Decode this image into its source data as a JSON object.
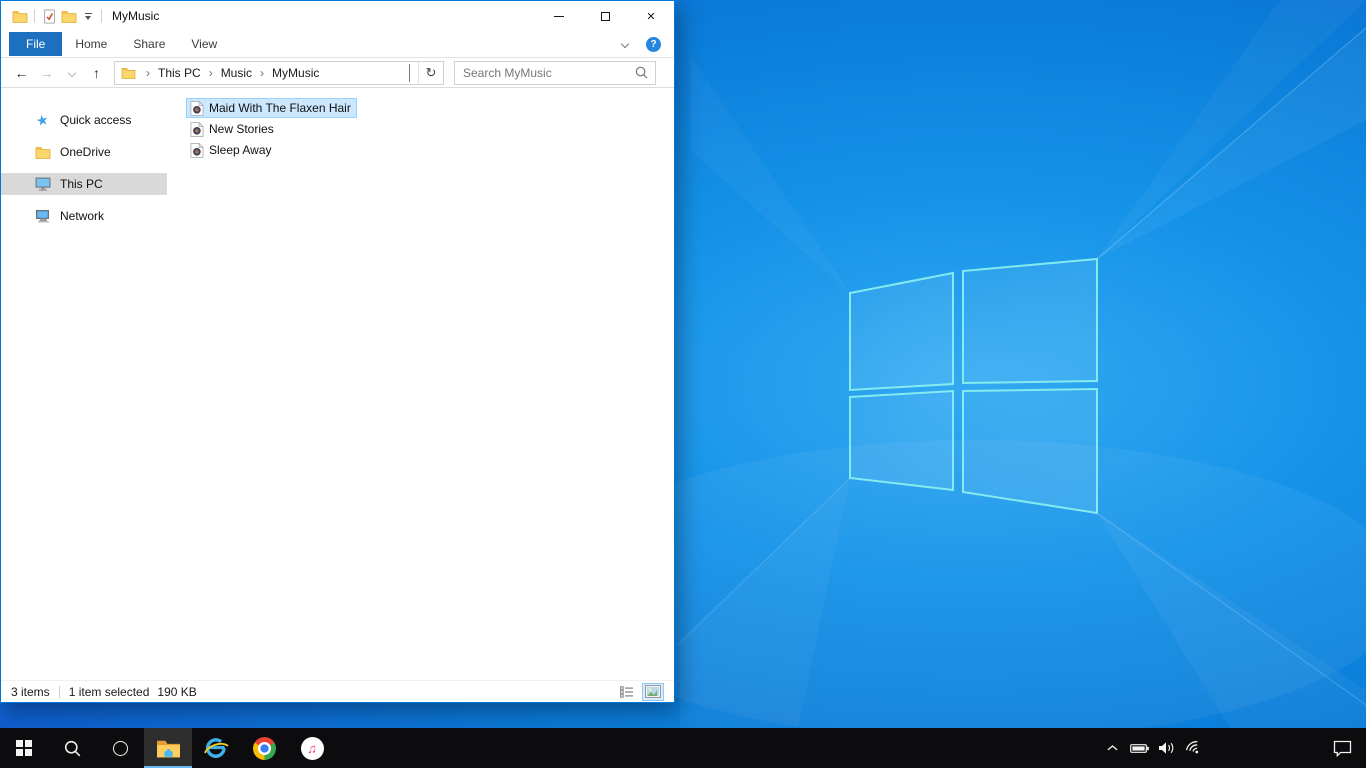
{
  "window": {
    "title": "MyMusic"
  },
  "ribbon": {
    "tabs": [
      "File",
      "Home",
      "Share",
      "View"
    ]
  },
  "address": {
    "breadcrumb": [
      "This PC",
      "Music",
      "MyMusic"
    ],
    "search_placeholder": "Search MyMusic"
  },
  "sidebar": {
    "items": [
      {
        "label": "Quick access",
        "icon": "quick-access-star"
      },
      {
        "label": "OneDrive",
        "icon": "onedrive-folder"
      },
      {
        "label": "This PC",
        "icon": "this-pc-monitor",
        "selected": true
      },
      {
        "label": "Network",
        "icon": "network-pc"
      }
    ]
  },
  "files": [
    {
      "name": "Maid With The Flaxen Hair",
      "icon": "audio-file",
      "selected": true
    },
    {
      "name": "New Stories",
      "icon": "audio-file",
      "selected": false
    },
    {
      "name": "Sleep Away",
      "icon": "audio-file",
      "selected": false
    }
  ],
  "statusbar": {
    "count": "3 items",
    "selected": "1 item selected",
    "size": "190 KB",
    "views": [
      "details-view",
      "thumbnail-view"
    ],
    "active_view": "thumbnail-view"
  },
  "taskbar": {
    "buttons": [
      "start",
      "search",
      "cortana",
      "file-explorer",
      "internet-explorer",
      "chrome",
      "itunes"
    ],
    "active_button": "file-explorer",
    "tray": [
      "tray-expand",
      "battery",
      "volume",
      "wifi",
      "action-center"
    ]
  },
  "icons": {
    "close": "×",
    "back": "←",
    "forward": "→",
    "up": "↑",
    "refresh": "↻",
    "crumb_sep": "›",
    "star": "★",
    "help": "?",
    "music_note": "♫"
  },
  "colors": {
    "accent": "#0078d7",
    "file-tab": "#1d70bd",
    "sel-bg": "#cce8ff",
    "sel-border": "#99d1ff",
    "taskbar-bg": "#0c0c0e",
    "wallpaper-center": "#33a9f1",
    "wallpaper-corner": "#1b47c6",
    "logo-stroke": "#8ef2ee"
  }
}
